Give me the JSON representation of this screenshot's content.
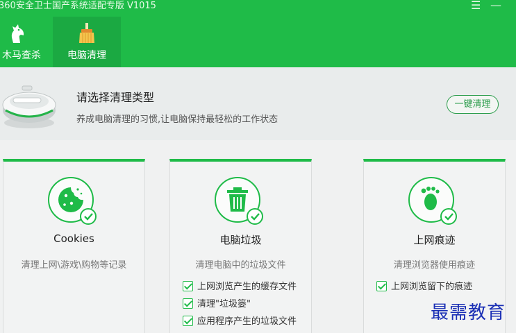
{
  "titlebar": {
    "title": "360安全卫士国产系统适配专版  V1015",
    "menu_glyph": "☰",
    "minimize_glyph": "—"
  },
  "tabs": [
    {
      "label": "木马查杀",
      "icon": "horse-icon"
    },
    {
      "label": "电脑清理",
      "icon": "broom-icon"
    }
  ],
  "banner": {
    "title": "请选择清理类型",
    "subtitle": "养成电脑清理的习惯,让电脑保持最轻松的工作状态",
    "one_click_label": "一键清理",
    "illustration": "robot-vacuum-icon"
  },
  "cards": [
    {
      "title": "Cookies",
      "desc": "清理上网\\游戏\\购物等记录",
      "icon": "cookie-icon",
      "options": []
    },
    {
      "title": "电脑垃圾",
      "desc": "清理电脑中的垃圾文件",
      "icon": "trash-icon",
      "options": [
        "上网浏览产生的缓存文件",
        "清理\"垃圾篓\"",
        "应用程序产生的垃圾文件"
      ]
    },
    {
      "title": "上网痕迹",
      "desc": "清理浏览器使用痕迹",
      "icon": "footprint-icon",
      "options": [
        "上网浏览留下的痕迹"
      ]
    }
  ],
  "watermark": "最需教育",
  "colors": {
    "brand_green": "#1fbb48",
    "active_tab": "#1ba942",
    "banner_bg": "#e9ecec"
  }
}
